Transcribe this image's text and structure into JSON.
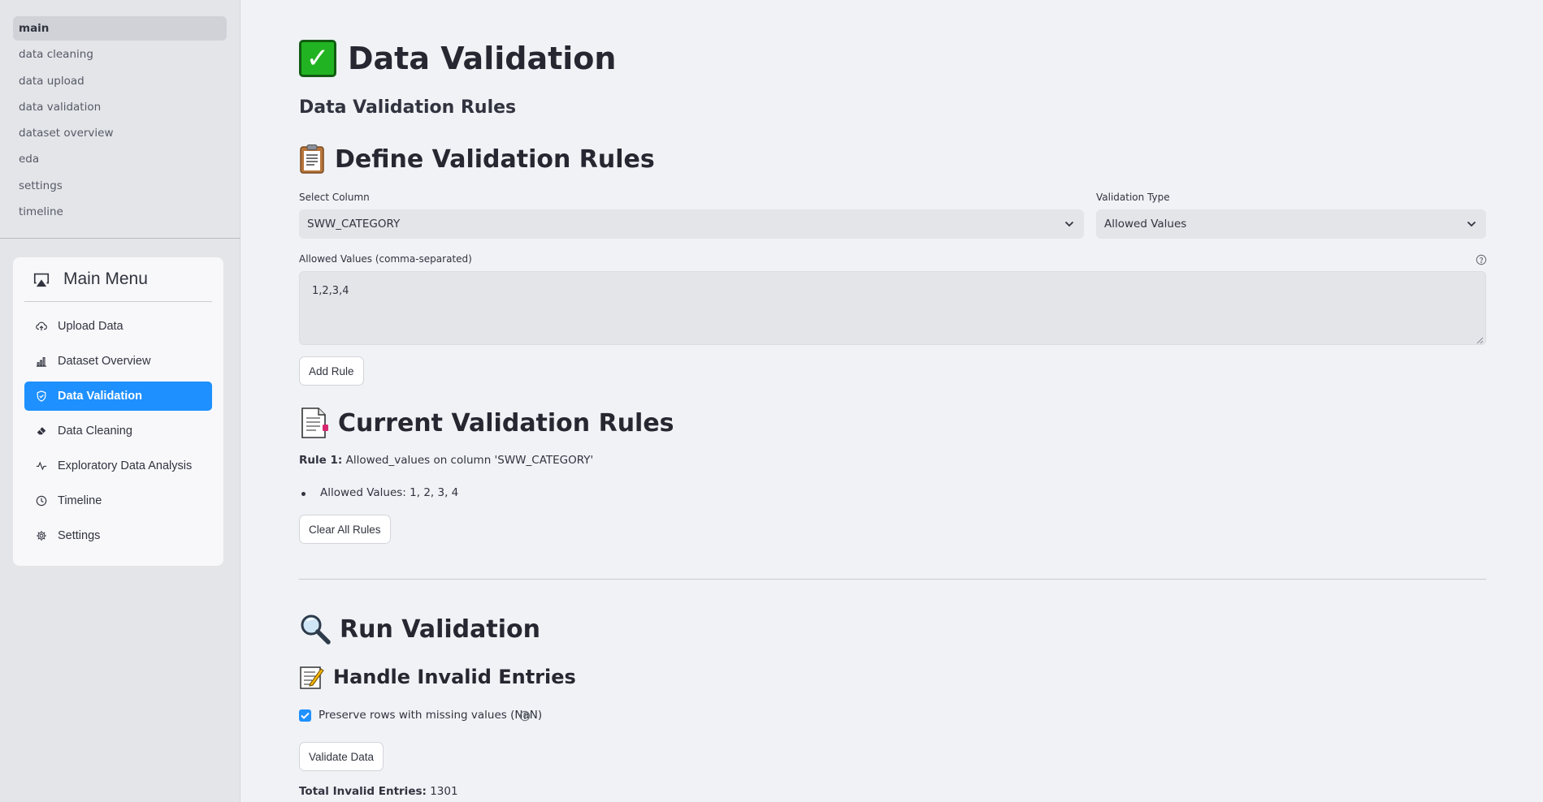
{
  "pages_nav": {
    "items": [
      {
        "label": "main",
        "active": true
      },
      {
        "label": "data cleaning",
        "active": false
      },
      {
        "label": "data upload",
        "active": false
      },
      {
        "label": "data validation",
        "active": false
      },
      {
        "label": "dataset overview",
        "active": false
      },
      {
        "label": "eda",
        "active": false
      },
      {
        "label": "settings",
        "active": false
      },
      {
        "label": "timeline",
        "active": false
      }
    ]
  },
  "main_menu": {
    "title": "Main Menu",
    "items": [
      {
        "label": "Upload Data",
        "icon": "cloud-upload-icon",
        "active": false
      },
      {
        "label": "Dataset Overview",
        "icon": "bar-chart-icon",
        "active": false
      },
      {
        "label": "Data Validation",
        "icon": "shield-check-icon",
        "active": true
      },
      {
        "label": "Data Cleaning",
        "icon": "eraser-icon",
        "active": false
      },
      {
        "label": "Exploratory Data Analysis",
        "icon": "activity-icon",
        "active": false
      },
      {
        "label": "Timeline",
        "icon": "clock-icon",
        "active": false
      },
      {
        "label": "Settings",
        "icon": "gear-icon",
        "active": false
      }
    ],
    "accent_color": "#1e90ff"
  },
  "page": {
    "title": "Data Validation",
    "subtitle": "Data Validation Rules"
  },
  "define_rules": {
    "heading": "Define Validation Rules",
    "column_label": "Select Column",
    "column_value": "SWW_CATEGORY",
    "type_label": "Validation Type",
    "type_value": "Allowed Values",
    "allowed_label": "Allowed Values (comma-separated)",
    "allowed_value": "1,2,3,4",
    "add_button": "Add Rule"
  },
  "current_rules": {
    "heading": "Current Validation Rules",
    "rules": [
      {
        "prefix": "Rule 1:",
        "text": "Allowed_values on column 'SWW_CATEGORY'",
        "detail": "Allowed Values: 1, 2, 3, 4"
      }
    ],
    "clear_button": "Clear All Rules"
  },
  "run_validation": {
    "heading": "Run Validation",
    "handle_heading": "Handle Invalid Entries",
    "preserve_label": "Preserve rows with missing values (NaN)",
    "preserve_checked": true,
    "validate_button": "Validate Data",
    "total_label": "Total Invalid Entries:",
    "total_value": "1301"
  }
}
